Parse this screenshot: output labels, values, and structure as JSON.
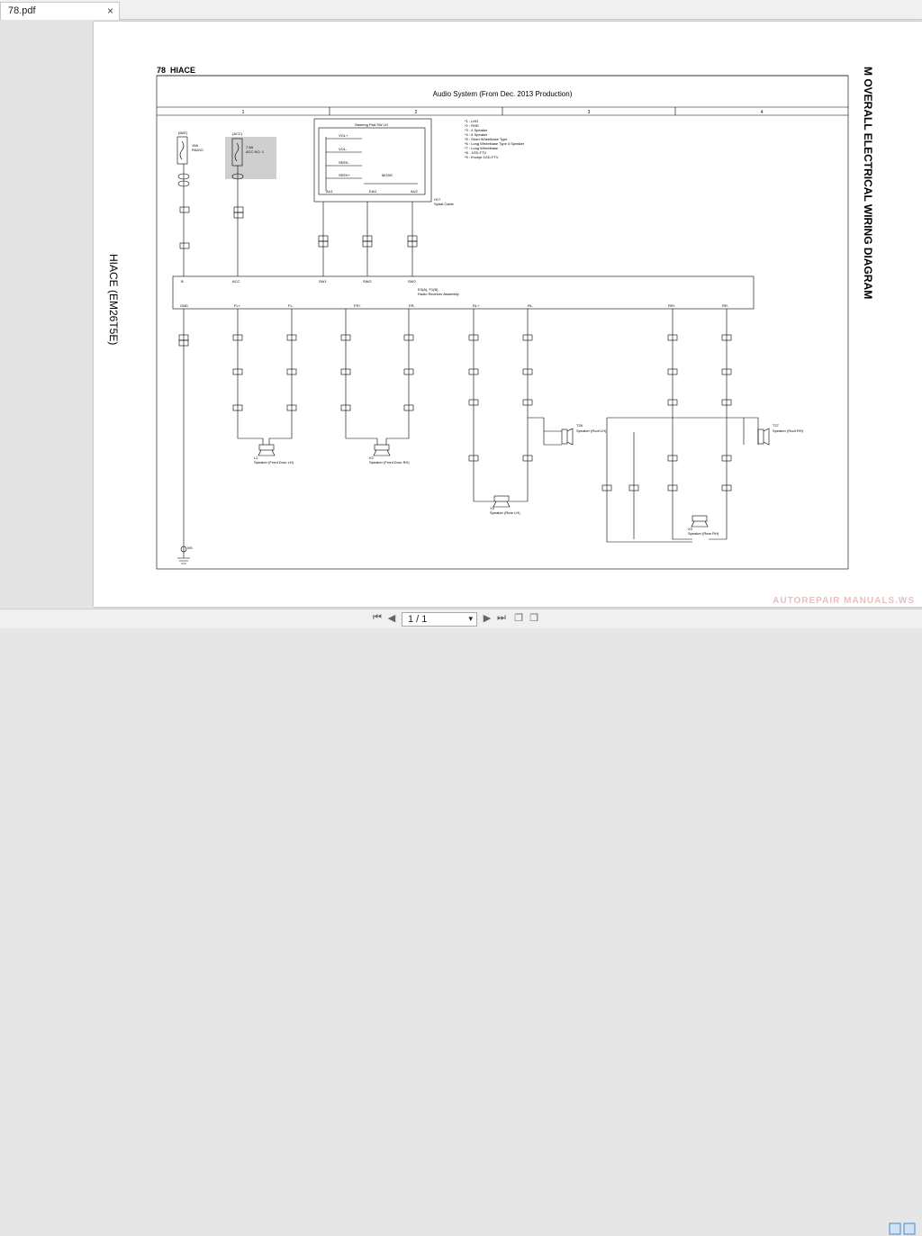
{
  "tab": {
    "title": "78.pdf",
    "close": "×"
  },
  "doc": {
    "page_number": "78",
    "model": "HIACE",
    "system_title": "Audio System (From Dec. 2013 Production)",
    "side_title": "M OVERALL ELECTRICAL WIRING DIAGRAM",
    "side_engine": "HIACE (EM26T5E)",
    "columns": [
      "1",
      "2",
      "3",
      "4"
    ],
    "notes": [
      "*1 : LHD",
      "*2 : RHD",
      "*3 : 4 Speaker",
      "*4 : 6 Speaker",
      "*5 : Short Wheelbase Type",
      "*6 : Long Wheelbase Type 4 Speaker",
      "*7 : Long Wheelbase",
      "*8 : 1GD-FTV",
      "*9 : Except 1GD-FTV"
    ],
    "fuse_radio": {
      "source": "(BAT)",
      "rating": "15A",
      "name": "RADIO"
    },
    "fuse_acc": {
      "source": "(ACC)",
      "rating": "7.5A",
      "name": "ACC NO. 1"
    },
    "steering_sw": "Steering Pad SW LH",
    "spiral_cable": {
      "id": "H17",
      "name": "Spiral Cable"
    },
    "switches": [
      "VOL+",
      "VOL-",
      "SEEK-",
      "SEEK+",
      "MODE"
    ],
    "switch_pins": [
      "AU1",
      "EAU",
      "AU2"
    ],
    "radio": {
      "id": "E3(A), F1(B)",
      "name": "Radio Receiver Assembly"
    },
    "radio_top_pins": [
      "B",
      "ACC",
      "SW1",
      "SWG",
      "SW2"
    ],
    "radio_bottom_pins": [
      "GND",
      "FL+",
      "FL-",
      "FR+",
      "FR-",
      "RL+",
      "RL-",
      "RR+",
      "RR-"
    ],
    "speakers": [
      {
        "id": "L2",
        "name": "Speaker (Front Door LH)"
      },
      {
        "id": "K2",
        "name": "Speaker (Front Door RH)"
      },
      {
        "id": "Y5",
        "name": "Speaker (Rear LH)"
      },
      {
        "id": "X3",
        "name": "Speaker (Rear RH)"
      },
      {
        "id": "T26",
        "name": "Speaker (Roof LH)"
      },
      {
        "id": "T27",
        "name": "Speaker (Roof RH)"
      }
    ],
    "connectors": [
      "IH1",
      "HI1",
      "IH2",
      "IH3",
      "IH4",
      "SH1",
      "EH1",
      "IN1",
      "HA2",
      "LA2",
      "KA2",
      "BT2",
      "TV6",
      "TU6",
      "TX1",
      "UX1"
    ],
    "ground": "W1"
  },
  "pager": {
    "current": "1 / 1"
  },
  "watermark": "AUTOREPAIR MANUALS.WS"
}
